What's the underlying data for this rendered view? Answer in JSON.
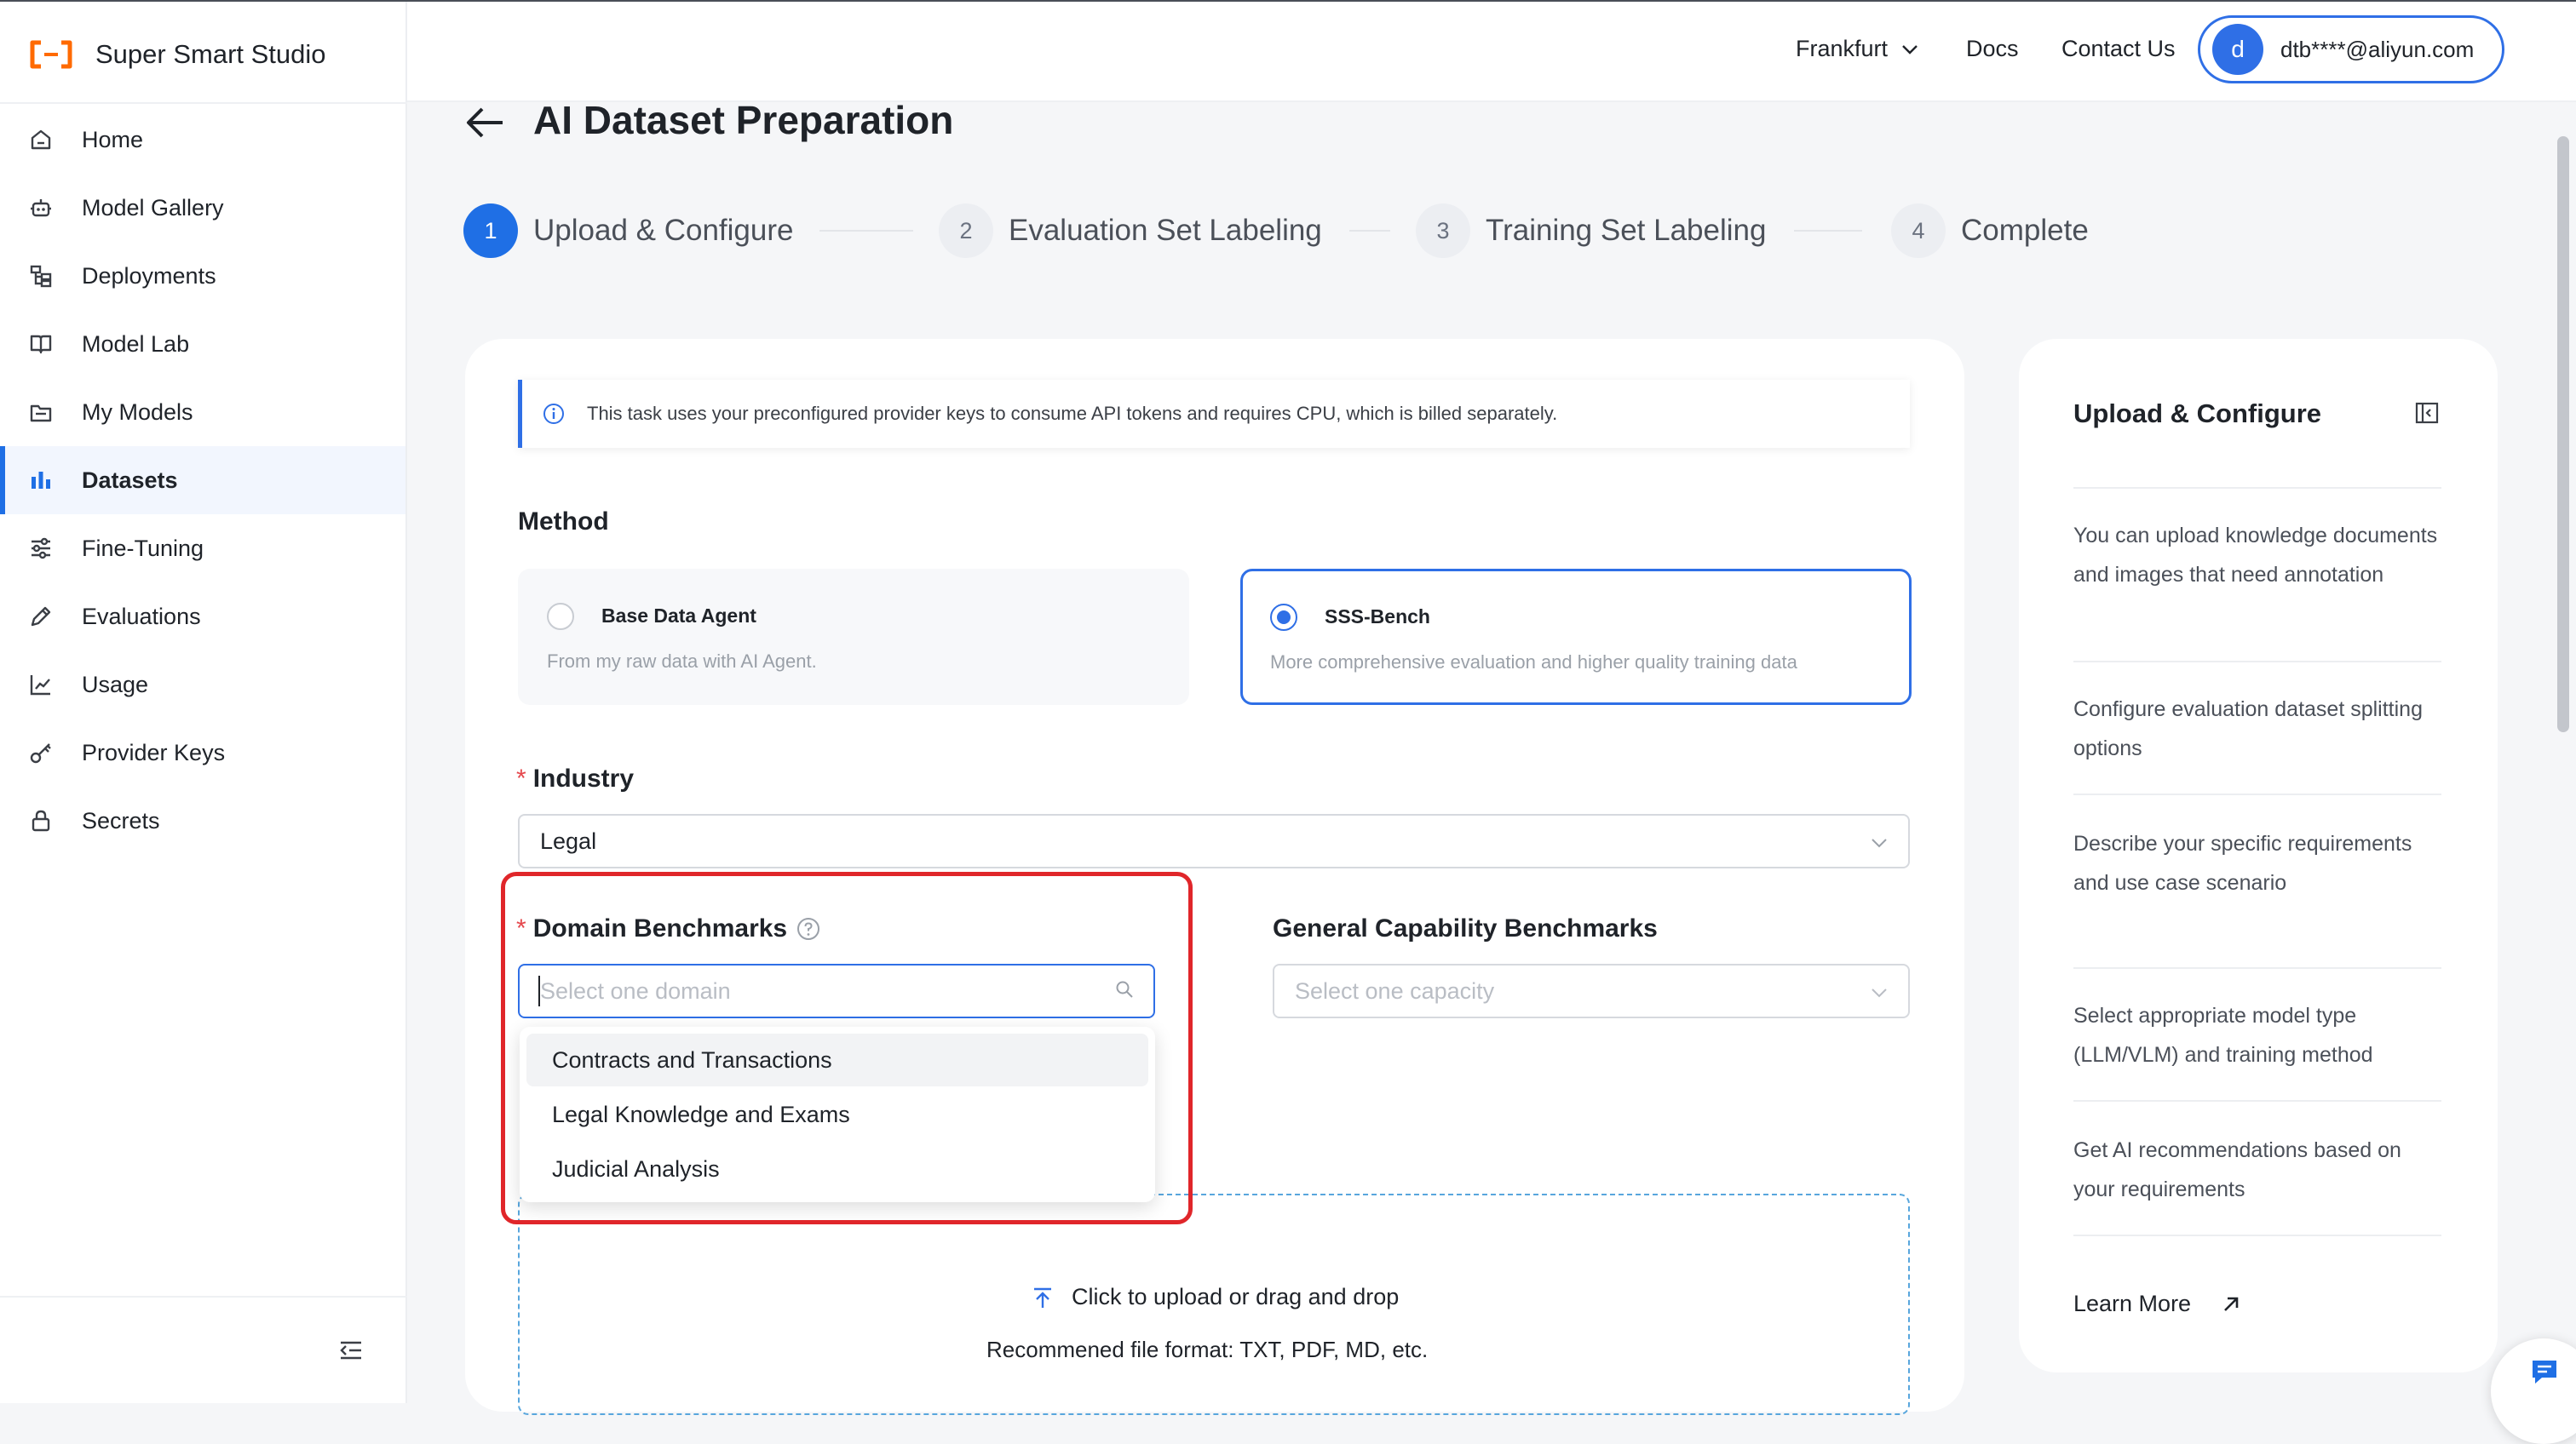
{
  "app": {
    "name": "Super Smart Studio"
  },
  "colors": {
    "accent": "#1f6fe5",
    "highlight": "#e0262a",
    "upload_border": "#58a6dd"
  },
  "sidebar": {
    "items": [
      {
        "label": "Home",
        "icon": "home-icon"
      },
      {
        "label": "Model Gallery",
        "icon": "robot-icon"
      },
      {
        "label": "Deployments",
        "icon": "hierarchy-icon"
      },
      {
        "label": "Model Lab",
        "icon": "book-icon"
      },
      {
        "label": "My Models",
        "icon": "folder-icon"
      },
      {
        "label": "Datasets",
        "icon": "bar-chart-icon",
        "active": true
      },
      {
        "label": "Fine-Tuning",
        "icon": "sliders-icon"
      },
      {
        "label": "Evaluations",
        "icon": "pencil-icon"
      },
      {
        "label": "Usage",
        "icon": "usage-chart-icon"
      },
      {
        "label": "Provider Keys",
        "icon": "key-icon"
      },
      {
        "label": "Secrets",
        "icon": "lock-icon"
      }
    ]
  },
  "header": {
    "region": "Frankfurt",
    "docs": "Docs",
    "contact": "Contact Us",
    "account": {
      "initial": "d",
      "email": "dtb****@aliyun.com"
    }
  },
  "page": {
    "title": "AI Dataset Preparation"
  },
  "steps": [
    {
      "number": "1",
      "label": "Upload & Configure",
      "active": true
    },
    {
      "number": "2",
      "label": "Evaluation Set Labeling"
    },
    {
      "number": "3",
      "label": "Training Set Labeling"
    },
    {
      "number": "4",
      "label": "Complete"
    }
  ],
  "notice": "This task uses your preconfigured provider keys to consume API tokens and requires CPU, which is billed separately.",
  "method": {
    "label": "Method",
    "options": [
      {
        "title": "Base Data Agent",
        "desc": "From my raw data with AI Agent.",
        "selected": false
      },
      {
        "title": "SSS-Bench",
        "desc": "More comprehensive evaluation and higher quality training data",
        "selected": true
      }
    ]
  },
  "industry": {
    "label": "Industry",
    "required": "*",
    "value": "Legal"
  },
  "domain": {
    "label": "Domain Benchmarks",
    "required": "*",
    "placeholder": "Select one domain",
    "options": [
      "Contracts and Transactions",
      "Legal Knowledge and Exams",
      "Judicial Analysis"
    ]
  },
  "general": {
    "label": "General Capability Benchmarks",
    "placeholder": "Select one capacity"
  },
  "upload": {
    "text": "Click to upload or drag and drop",
    "hint": "Recommened file format: TXT, PDF, MD, etc."
  },
  "guide": {
    "title": "Upload & Configure",
    "items": [
      "You can upload knowledge documents and images that need annotation",
      "Configure evaluation dataset splitting options",
      "Describe your specific requirements and use case scenario",
      "Select appropriate model type (LLM/VLM) and training method",
      "Get AI recommendations based on your requirements"
    ],
    "learn_more": "Learn More"
  }
}
